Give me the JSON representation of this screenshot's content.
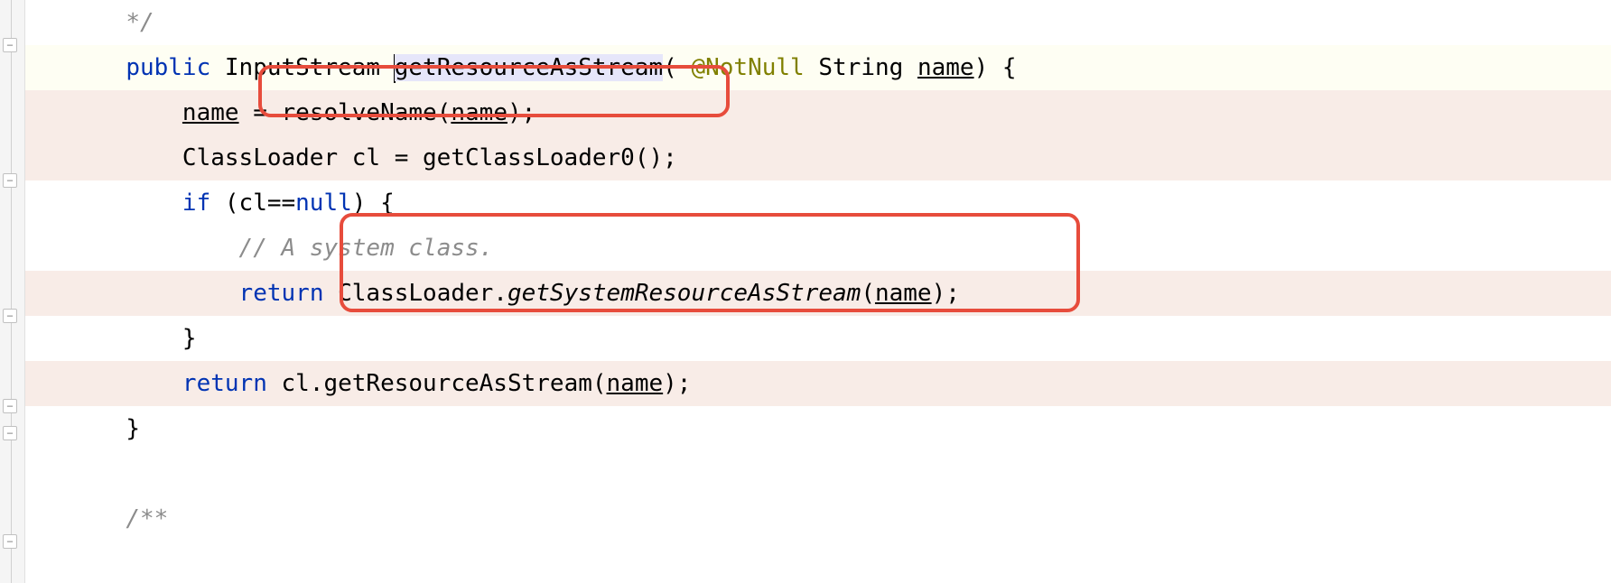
{
  "lines": {
    "l0": {
      "comment_close": "*/"
    },
    "l1": {
      "kw_public": "public",
      "type": "InputStream",
      "method": "getResourceAsStream",
      "annotation": "@NotNull",
      "param_type": "String",
      "param_name": "name"
    },
    "l2": {
      "var": "name",
      "assign": " = resolveName(",
      "arg": "name",
      "close": ");"
    },
    "l3": {
      "text": "ClassLoader cl = getClassLoader0();"
    },
    "l4": {
      "kw_if": "if",
      "cond_open": " (cl==",
      "kw_null": "null",
      "cond_close": ") {"
    },
    "l5": {
      "comment": "// A system class."
    },
    "l6": {
      "kw_return": "return",
      "cls": " ClassLoader.",
      "static_method": "getSystemResourceAsStream",
      "open": "(",
      "arg": "name",
      "close": ");"
    },
    "l7": {
      "brace": "}"
    },
    "l8": {
      "kw_return": "return",
      "text": " cl.getResourceAsStream(",
      "arg": "name",
      "close": ");"
    },
    "l9": {
      "brace": "}"
    },
    "l11": {
      "comment_open": "/**"
    }
  }
}
